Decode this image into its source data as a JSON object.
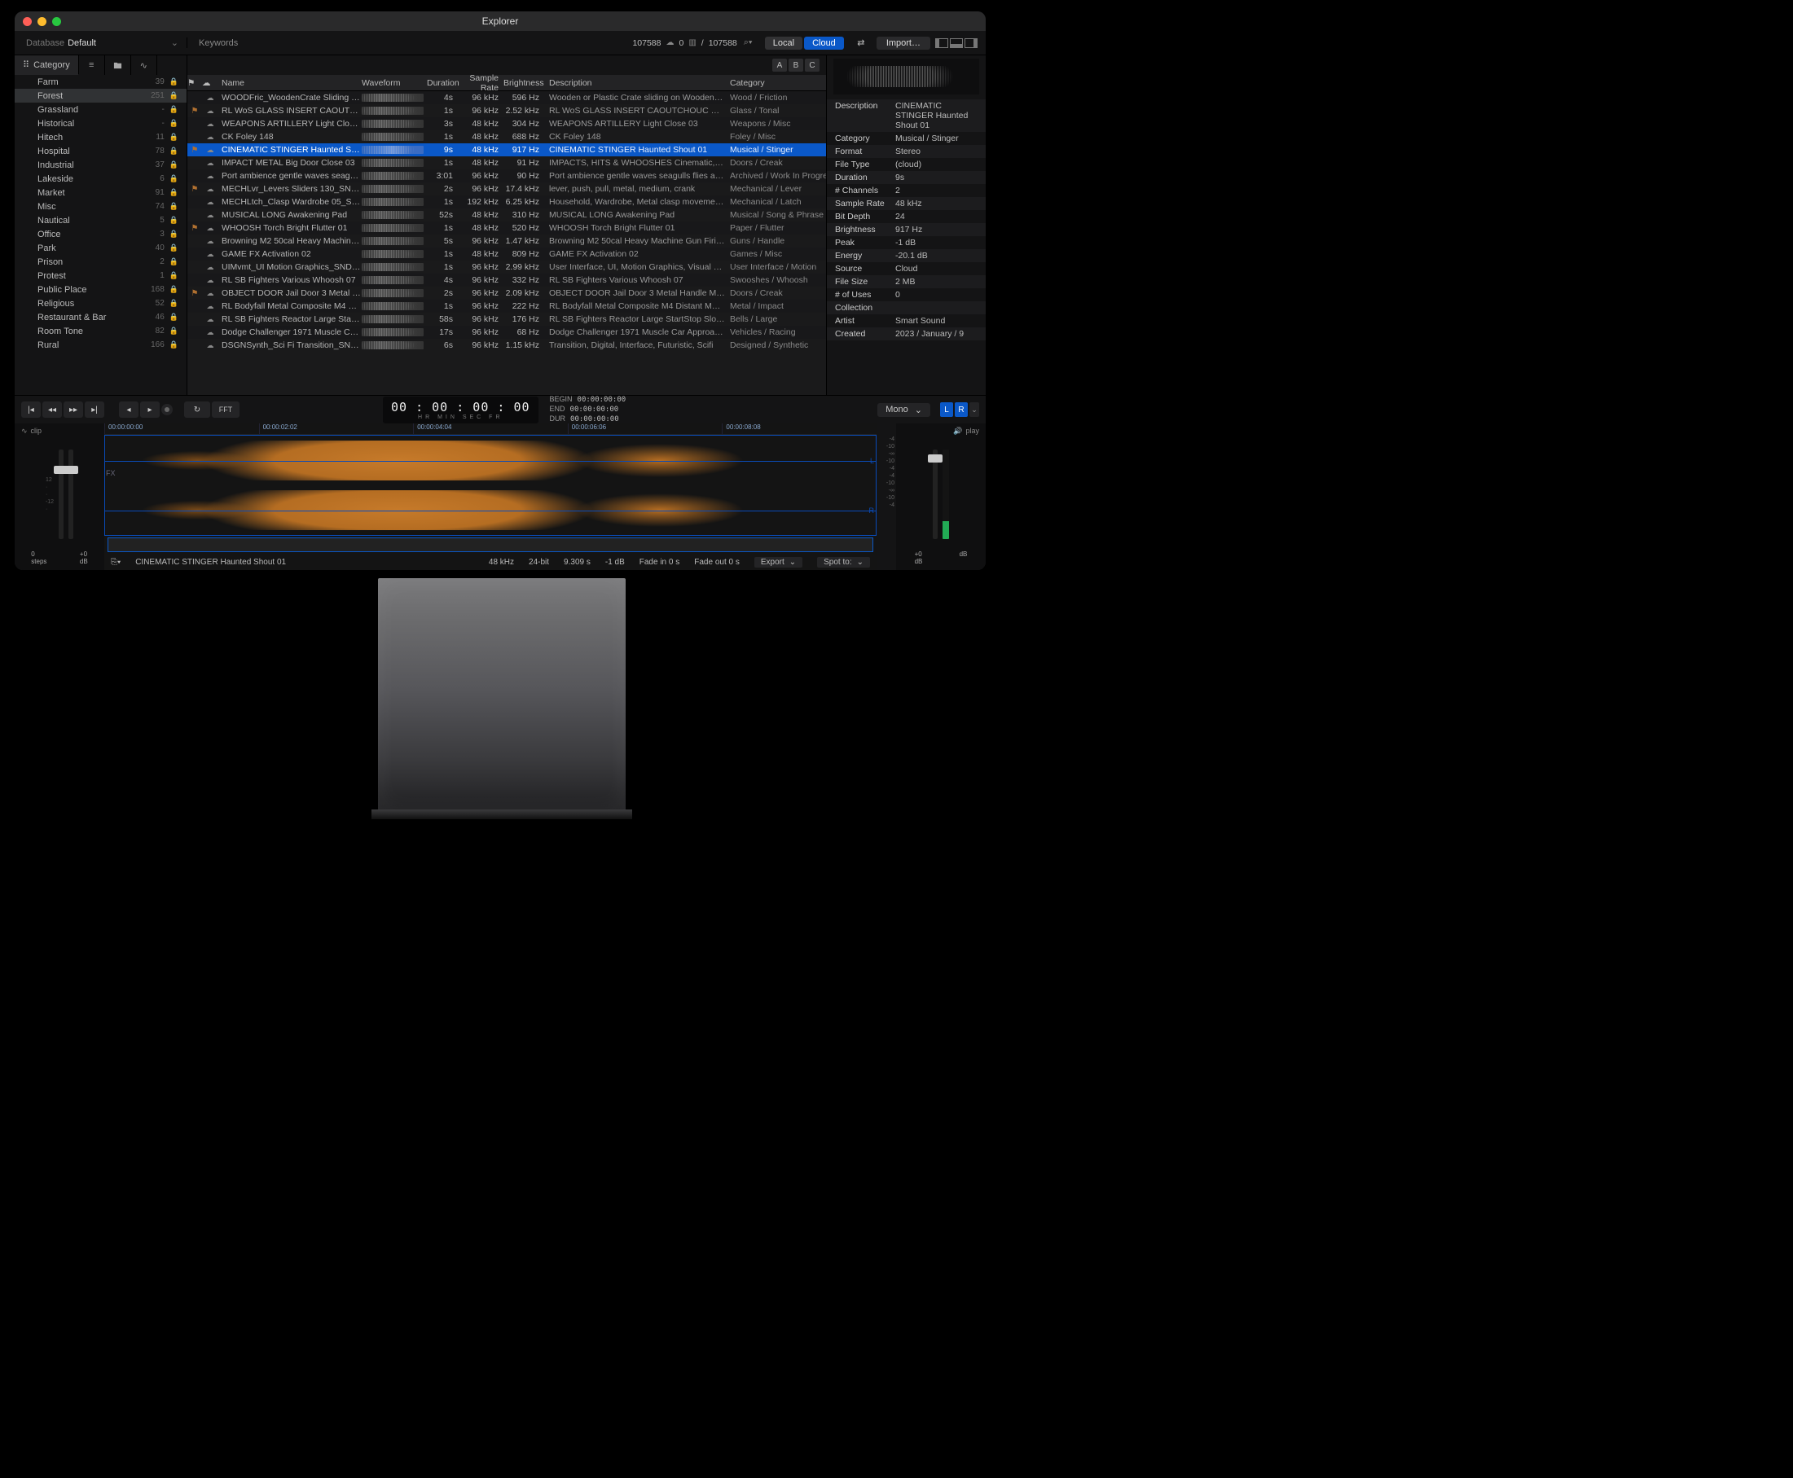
{
  "window": {
    "title": "Explorer"
  },
  "toolbar": {
    "database_label": "Database",
    "database_name": "Default",
    "keywords_label": "Keywords",
    "count_left": "107588",
    "count_cloud": "0",
    "count_right": "107588",
    "local_label": "Local",
    "cloud_label": "Cloud",
    "import_label": "Import…"
  },
  "left": {
    "tab_category": "Category",
    "categories": [
      {
        "name": "Farm",
        "count": "39"
      },
      {
        "name": "Forest",
        "count": "251"
      },
      {
        "name": "Grassland",
        "count": "-"
      },
      {
        "name": "Historical",
        "count": "-"
      },
      {
        "name": "Hitech",
        "count": "11"
      },
      {
        "name": "Hospital",
        "count": "78"
      },
      {
        "name": "Industrial",
        "count": "37"
      },
      {
        "name": "Lakeside",
        "count": "6"
      },
      {
        "name": "Market",
        "count": "91"
      },
      {
        "name": "Misc",
        "count": "74"
      },
      {
        "name": "Nautical",
        "count": "5"
      },
      {
        "name": "Office",
        "count": "3"
      },
      {
        "name": "Park",
        "count": "40"
      },
      {
        "name": "Prison",
        "count": "2"
      },
      {
        "name": "Protest",
        "count": "1"
      },
      {
        "name": "Public Place",
        "count": "168"
      },
      {
        "name": "Religious",
        "count": "52"
      },
      {
        "name": "Restaurant & Bar",
        "count": "46"
      },
      {
        "name": "Room Tone",
        "count": "82"
      },
      {
        "name": "Rural",
        "count": "166"
      }
    ]
  },
  "abc": {
    "a": "A",
    "b": "B",
    "c": "C"
  },
  "columns": {
    "name": "Name",
    "waveform": "Waveform",
    "duration": "Duration",
    "samplerate": "Sample Rate",
    "brightness": "Brightness",
    "description": "Description",
    "category": "Category"
  },
  "rows": [
    {
      "flag": "",
      "name": "WOODFric_WoodenCrate Sliding on Parque",
      "dur": "4s",
      "sr": "96 kHz",
      "br": "596 Hz",
      "desc": "Wooden or Plastic Crate sliding on Wooden Floor, Drag,",
      "cat": "Wood / Friction"
    },
    {
      "flag": "⚑",
      "name": "RL WoS GLASS INSERT CAOUTCHOUC PL",
      "dur": "1s",
      "sr": "96 kHz",
      "br": "2.52 kHz",
      "desc": "RL WoS GLASS INSERT CAOUTCHOUC PLUG ON GLAS",
      "cat": "Glass / Tonal"
    },
    {
      "flag": "",
      "name": "WEAPONS ARTILLERY Light Close 03",
      "dur": "3s",
      "sr": "48 kHz",
      "br": "304 Hz",
      "desc": "WEAPONS ARTILLERY Light Close 03",
      "cat": "Weapons / Misc"
    },
    {
      "flag": "",
      "name": "CK Foley 148",
      "dur": "1s",
      "sr": "48 kHz",
      "br": "688 Hz",
      "desc": "CK Foley 148",
      "cat": "Foley / Misc"
    },
    {
      "flag": "⚑",
      "name": "CINEMATIC STINGER Haunted Shout 01",
      "dur": "9s",
      "sr": "48 kHz",
      "br": "917 Hz",
      "desc": "CINEMATIC STINGER Haunted Shout 01",
      "cat": "Musical / Stinger",
      "sel": true
    },
    {
      "flag": "",
      "name": "IMPACT METAL Big Door Close 03",
      "dur": "1s",
      "sr": "48 kHz",
      "br": "91 Hz",
      "desc": "IMPACTS, HITS & WHOOSHES Cinematic, Trailer, Bell, Hi",
      "cat": "Doors / Creak"
    },
    {
      "flag": "",
      "name": "Port ambience gentle waves seagulls flies",
      "dur": "3:01",
      "sr": "96 kHz",
      "br": "90 Hz",
      "desc": "Port ambience gentle waves seagulls flies and other su",
      "cat": "Archived / Work In Progress"
    },
    {
      "flag": "⚑",
      "name": "MECHLvr_Levers Sliders 130_SNDBTS_BS.",
      "dur": "2s",
      "sr": "96 kHz",
      "br": "17.4 kHz",
      "desc": "lever, push, pull, metal, medium, crank",
      "cat": "Mechanical / Lever"
    },
    {
      "flag": "",
      "name": "MECHLtch_Clasp Wardrobe 05_SNDBTS_A",
      "dur": "1s",
      "sr": "192 kHz",
      "br": "6.25 kHz",
      "desc": "Household, Wardrobe, Metal clasp movement, Clicks an",
      "cat": "Mechanical / Latch"
    },
    {
      "flag": "",
      "name": "MUSICAL LONG Awakening Pad",
      "dur": "52s",
      "sr": "48 kHz",
      "br": "310 Hz",
      "desc": "MUSICAL LONG Awakening Pad",
      "cat": "Musical / Song & Phrase"
    },
    {
      "flag": "⚑",
      "name": "WHOOSH Torch Bright Flutter 01",
      "dur": "1s",
      "sr": "48 kHz",
      "br": "520 Hz",
      "desc": "WHOOSH Torch Bright Flutter 01",
      "cat": "Paper / Flutter"
    },
    {
      "flag": "",
      "name": "Browning M2 50cal Heavy Machine Gun  Fi",
      "dur": "5s",
      "sr": "96 kHz",
      "br": "1.47 kHz",
      "desc": "Browning M2 50cal Heavy Machine Gun  Firing  Short B",
      "cat": "Guns / Handle"
    },
    {
      "flag": "",
      "name": "GAME FX Activation 02",
      "dur": "1s",
      "sr": "48 kHz",
      "br": "809 Hz",
      "desc": "GAME FX Activation 02",
      "cat": "Games / Misc"
    },
    {
      "flag": "",
      "name": "UIMvmt_UI Motion Graphics_SNDBTS_CSF",
      "dur": "1s",
      "sr": "96 kHz",
      "br": "2.99 kHz",
      "desc": "User Interface, UI, Motion Graphics, Visual Feedback, M",
      "cat": "User Interface / Motion"
    },
    {
      "flag": "",
      "name": "RL SB Fighters Various Whoosh 07",
      "dur": "4s",
      "sr": "96 kHz",
      "br": "332 Hz",
      "desc": "RL SB Fighters Various Whoosh 07",
      "cat": "Swooshes / Whoosh"
    },
    {
      "flag": "⚑",
      "name": "OBJECT DOOR Jail Door 3 Metal Handle M",
      "dur": "2s",
      "sr": "96 kHz",
      "br": "2.09 kHz",
      "desc": "OBJECT DOOR Jail Door 3 Metal Handle Medium Outsi",
      "cat": "Doors / Creak"
    },
    {
      "flag": "",
      "name": "RL Bodyfall Metal Composite M4 Distant M",
      "dur": "1s",
      "sr": "96 kHz",
      "br": "222 Hz",
      "desc": "RL Bodyfall Metal Composite M4 Distant Mono Hard Im",
      "cat": "Metal / Impact"
    },
    {
      "flag": "",
      "name": "RL SB Fighters Reactor Large StartStop Slo",
      "dur": "58s",
      "sr": "96 kHz",
      "br": "176 Hz",
      "desc": "RL SB Fighters Reactor Large StartStop Slow 01",
      "cat": "Bells / Large"
    },
    {
      "flag": "",
      "name": "Dodge Challenger 1971 Muscle Car  Appro",
      "dur": "17s",
      "sr": "96 kHz",
      "br": "68 Hz",
      "desc": "Dodge Challenger 1971 Muscle Car  Approaching Slow",
      "cat": "Vehicles / Racing"
    },
    {
      "flag": "",
      "name": "DSGNSynth_Sci Fi Transition_SNDBTS_JFS",
      "dur": "6s",
      "sr": "96 kHz",
      "br": "1.15 kHz",
      "desc": "Transition, Digital, Interface, Futuristic, Scifi",
      "cat": "Designed / Synthetic"
    }
  ],
  "meta": [
    {
      "k": "Description",
      "v": "CINEMATIC STINGER Haunted Shout 01"
    },
    {
      "k": "Category",
      "v": "Musical / Stinger"
    },
    {
      "k": "Format",
      "v": "Stereo"
    },
    {
      "k": "File Type",
      "v": "(cloud)"
    },
    {
      "k": "Duration",
      "v": "9s"
    },
    {
      "k": "# Channels",
      "v": "2"
    },
    {
      "k": "Sample Rate",
      "v": "48 kHz"
    },
    {
      "k": "Bit Depth",
      "v": "24"
    },
    {
      "k": "Brightness",
      "v": "917 Hz"
    },
    {
      "k": "Peak",
      "v": "-1 dB"
    },
    {
      "k": "Energy",
      "v": "-20.1 dB"
    },
    {
      "k": "Source",
      "v": "Cloud"
    },
    {
      "k": "File Size",
      "v": "2 MB"
    },
    {
      "k": "# of Uses",
      "v": "0"
    },
    {
      "k": "Collection",
      "v": ""
    },
    {
      "k": "Artist",
      "v": "Smart Sound"
    },
    {
      "k": "Created",
      "v": "2023 / January / 9"
    }
  ],
  "transport": {
    "fft": "FFT",
    "tc": "00 : 00 : 00 : 00",
    "tclabels": "HR   MIN   SEC   FR",
    "begin_lbl": "BEGIN",
    "begin": "00:00:00:00",
    "end_lbl": "END",
    "end": "00:00:00:00",
    "dur_lbl": "DUR",
    "dur": "00:00:00:00",
    "mono": "Mono",
    "L": "L",
    "R": "R"
  },
  "wave": {
    "clip_label": "clip",
    "play_label": "play",
    "fx_label": "FX",
    "ruler": [
      "00:00:00:00",
      "00:00:02:02",
      "00:00:04:04",
      "00:00:06:06",
      "00:00:08:08"
    ],
    "L": "L",
    "R": "R",
    "db_scale": [
      "-4",
      "-10",
      "-∞",
      "-10",
      "-4"
    ],
    "steps_val": "0",
    "steps_lbl": "steps",
    "db_val": "+0",
    "db_lbl": "dB",
    "r_db_val": "+0",
    "r_db_lbl": "dB"
  },
  "info": {
    "name": "CINEMATIC STINGER Haunted Shout 01",
    "sr": "48 kHz",
    "bit": "24-bit",
    "len": "9.309 s",
    "peak": "-1 dB",
    "fadein": "Fade in 0 s",
    "fadeout": "Fade out 0 s",
    "export": "Export",
    "spotto": "Spot to:"
  }
}
